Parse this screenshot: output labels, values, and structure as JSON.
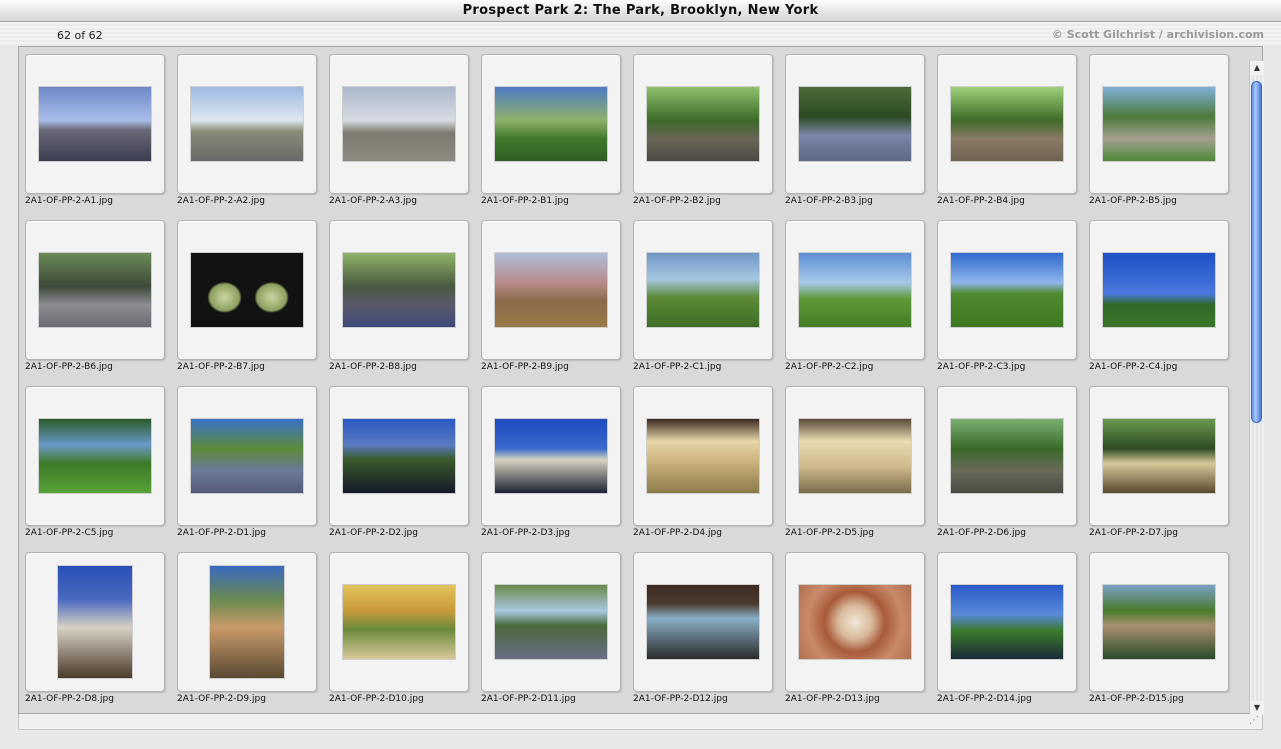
{
  "window": {
    "title": "Prospect Park 2: The Park, Brooklyn, New York"
  },
  "header": {
    "count": "62 of 62",
    "credit": "© Scott Gilchrist / archivision.com"
  },
  "thumbnails": [
    {
      "name": "2A1-OF-PP-2-A1.jpg",
      "o": "land",
      "bg": "linear-gradient(#6d88c8 0%, #a9bde8 45%, #6a6a7a 58%, #3d3d52 100%)"
    },
    {
      "name": "2A1-OF-PP-2-A2.jpg",
      "o": "land",
      "bg": "linear-gradient(#9fb9e2 0%, #dde6f1 45%, #8a8a78 60%, #6a6a6a 100%)"
    },
    {
      "name": "2A1-OF-PP-2-A3.jpg",
      "o": "land",
      "bg": "linear-gradient(#aab7cc 0%, #d7dbe2 45%, #7d7b6f 62%, #8c8a80 100%)"
    },
    {
      "name": "2A1-OF-PP-2-B1.jpg",
      "o": "land",
      "bg": "linear-gradient(#4e7cc7 0%, #8fb06a 45%, #3f7a2c 70%, #2e5e22 100%)"
    },
    {
      "name": "2A1-OF-PP-2-B2.jpg",
      "o": "land",
      "bg": "linear-gradient(#8fbf6a 0%, #3d6b2a 45%, #6a6556 70%, #4b4a44 100%)"
    },
    {
      "name": "2A1-OF-PP-2-B3.jpg",
      "o": "land",
      "bg": "linear-gradient(#4f6b3a 0%, #2b4a22 40%, #7b86a8 65%, #5e6788 100%)"
    },
    {
      "name": "2A1-OF-PP-2-B4.jpg",
      "o": "land",
      "bg": "linear-gradient(#9fcf7a 0%, #3f6b28 45%, #8a7a66 70%, #6f6352 100%)"
    },
    {
      "name": "2A1-OF-PP-2-B5.jpg",
      "o": "land",
      "bg": "linear-gradient(#7fb0d8 0%, #4c7a3a 40%, #a4a090 70%, #4e8a38 100%)"
    },
    {
      "name": "2A1-OF-PP-2-B6.jpg",
      "o": "land",
      "bg": "linear-gradient(#6a8a58 0%, #3e4a3a 45%, #8c8c92 70%, #6b6b74 100%)"
    },
    {
      "name": "2A1-OF-PP-2-B7.jpg",
      "o": "land",
      "bg": "radial-gradient(ellipse 22% 30% at 30% 60%, #c9d6a0 0%, #8ca060 60%, transparent 70%), radial-gradient(ellipse 22% 30% at 72% 60%, #c9d6a0 0%, #8ca060 60%, transparent 70%), #121212"
    },
    {
      "name": "2A1-OF-PP-2-B8.jpg",
      "o": "land",
      "bg": "linear-gradient(#8fb46a 0%, #4a5a40 45%, #5a5a6a 70%, #3e4a7a 100%)"
    },
    {
      "name": "2A1-OF-PP-2-B9.jpg",
      "o": "land",
      "bg": "linear-gradient(#aebfd8 0%, #b88a8a 40%, #8a6a4a 65%, #9a7a48 100%)"
    },
    {
      "name": "2A1-OF-PP-2-C1.jpg",
      "o": "land",
      "bg": "linear-gradient(#6f96c8 0%, #a6c7e0 35%, #5c8a38 60%, #3e6e26 100%)"
    },
    {
      "name": "2A1-OF-PP-2-C2.jpg",
      "o": "land",
      "bg": "linear-gradient(#5c8fd4 0%, #a7c8ea 40%, #5e9a36 62%, #447d26 100%)"
    },
    {
      "name": "2A1-OF-PP-2-C3.jpg",
      "o": "land",
      "bg": "linear-gradient(#2f6ad0 0%, #8fb6ea 40%, #4e8a30 55%, #3e7a22 100%)"
    },
    {
      "name": "2A1-OF-PP-2-C4.jpg",
      "o": "land",
      "bg": "linear-gradient(#1f4fc8 0%, #4a78dc 55%, #2f6a28 70%, #3a7628 100%)"
    },
    {
      "name": "2A1-OF-PP-2-C5.jpg",
      "o": "land",
      "bg": "linear-gradient(#2c5a2a 0%, #6a9ac8 35%, #3e7a28 60%, #58a236 100%)"
    },
    {
      "name": "2A1-OF-PP-2-D1.jpg",
      "o": "land",
      "bg": "linear-gradient(#3a72c8 0%, #5c8a3a 40%, #6b7a9a 70%, #545a78 100%)"
    },
    {
      "name": "2A1-OF-PP-2-D2.jpg",
      "o": "land",
      "bg": "linear-gradient(#2a58c4 0%, #5a7ac0 35%, #3a5a2a 55%, #151a2a 100%)"
    },
    {
      "name": "2A1-OF-PP-2-D3.jpg",
      "o": "land",
      "bg": "linear-gradient(#1f4abf 0%, #3a6acc 40%, #d8d2c0 55%, #1e2234 100%)"
    },
    {
      "name": "2A1-OF-PP-2-D4.jpg",
      "o": "land",
      "bg": "linear-gradient(#3b2a20 0%, #e6d6a8 30%, #c9b07a 60%, #8a7a4a 100%)"
    },
    {
      "name": "2A1-OF-PP-2-D5.jpg",
      "o": "land",
      "bg": "linear-gradient(#5a4a3a 0%, #e8dcb0 30%, #cdb88a 65%, #7a6a4a 100%)"
    },
    {
      "name": "2A1-OF-PP-2-D6.jpg",
      "o": "land",
      "bg": "linear-gradient(#7ab070 0%, #3a6a2a 40%, #6a6a5a 70%, #4a4a42 100%)"
    },
    {
      "name": "2A1-OF-PP-2-D7.jpg",
      "o": "land",
      "bg": "linear-gradient(#6a9a50 0%, #2e4a22 40%, #d8c89a 60%, #5a4a30 100%)"
    },
    {
      "name": "2A1-OF-PP-2-D8.jpg",
      "o": "port",
      "bg": "linear-gradient(#2a4fb8 0%, #4a6ac0 30%, #d8d2c4 55%, #4a3a2a 100%)"
    },
    {
      "name": "2A1-OF-PP-2-D9.jpg",
      "o": "port",
      "bg": "linear-gradient(#3a6ac0 0%, #6a8a50 30%, #c89a6a 55%, #5a4a32 100%)"
    },
    {
      "name": "2A1-OF-PP-2-D10.jpg",
      "o": "land",
      "bg": "linear-gradient(#e2c25a 0%, #c89a3a 35%, #6a8a3a 60%, #d8c89a 100%)"
    },
    {
      "name": "2A1-OF-PP-2-D11.jpg",
      "o": "land",
      "bg": "linear-gradient(#6a8a4a 0%, #a8c8e0 35%, #4a6a3a 55%, #6a6e86 100%)"
    },
    {
      "name": "2A1-OF-PP-2-D12.jpg",
      "o": "land",
      "bg": "linear-gradient(#3a2a22 0%, #4a3a2e 25%, #8ab0c8 45%, #2a2a2a 100%)"
    },
    {
      "name": "2A1-OF-PP-2-D13.jpg",
      "o": "land",
      "bg": "radial-gradient(circle at 50% 50%, #f2e8d8 0%, #d8b89a 25%, #a85a3a 45%, #c88a6a 70%, #b07050 100%)"
    },
    {
      "name": "2A1-OF-PP-2-D14.jpg",
      "o": "land",
      "bg": "linear-gradient(#2a5ac8 0%, #5a8ad8 40%, #3a7a2a 62%, #1a2a3a 100%)"
    },
    {
      "name": "2A1-OF-PP-2-D15.jpg",
      "o": "land",
      "bg": "linear-gradient(#7aa0c8 0%, #4a7a2a 35%, #a89070 55%, #2a4a2a 100%)"
    }
  ]
}
